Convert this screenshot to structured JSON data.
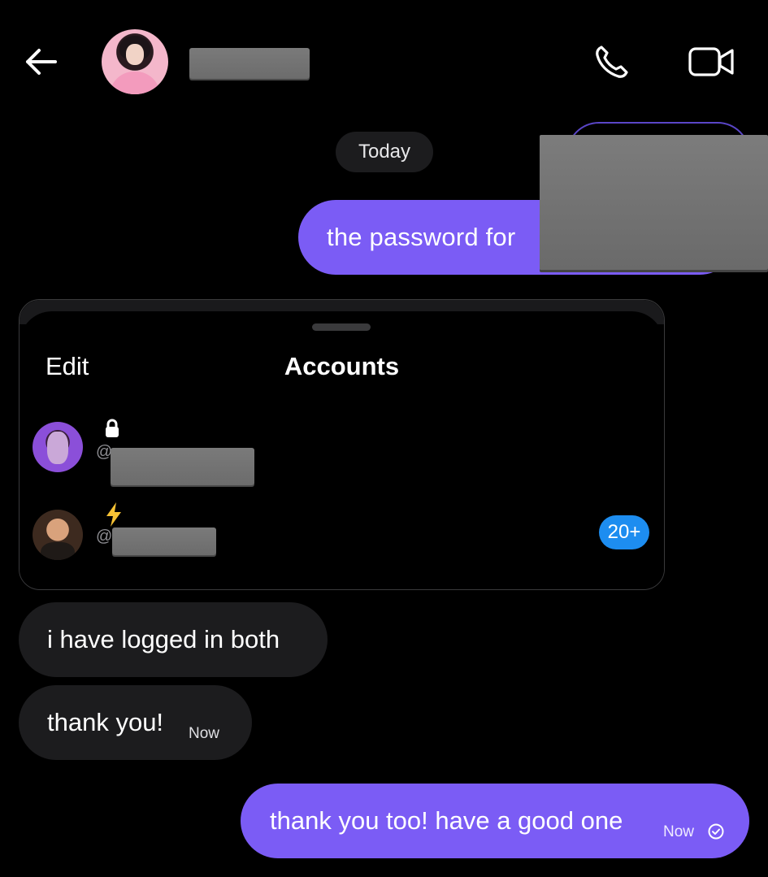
{
  "header": {
    "back_icon": "arrow-left-icon",
    "call_icon": "phone-icon",
    "video_icon": "video-camera-icon"
  },
  "date_separator": "Today",
  "messages": [
    {
      "direction": "outgoing",
      "text": "the password for"
    },
    {
      "direction": "incoming",
      "text": "i have logged in both"
    },
    {
      "direction": "incoming",
      "text": "thank you!",
      "time": "Now"
    },
    {
      "direction": "outgoing",
      "text": "thank you too! have a good one",
      "time": "Now",
      "status_icon": "check-circle-icon"
    }
  ],
  "shared_screenshot": {
    "edit_label": "Edit",
    "title": "Accounts",
    "accounts": [
      {
        "prefix": "@",
        "status_icon": "lock-icon"
      },
      {
        "prefix": "@",
        "status_icon": "lightning-icon",
        "badge": "20+"
      }
    ]
  },
  "colors": {
    "background": "#000000",
    "outgoing_bubble": "#7b5cf5",
    "incoming_bubble": "#1c1c1e",
    "badge": "#1d8df0"
  }
}
